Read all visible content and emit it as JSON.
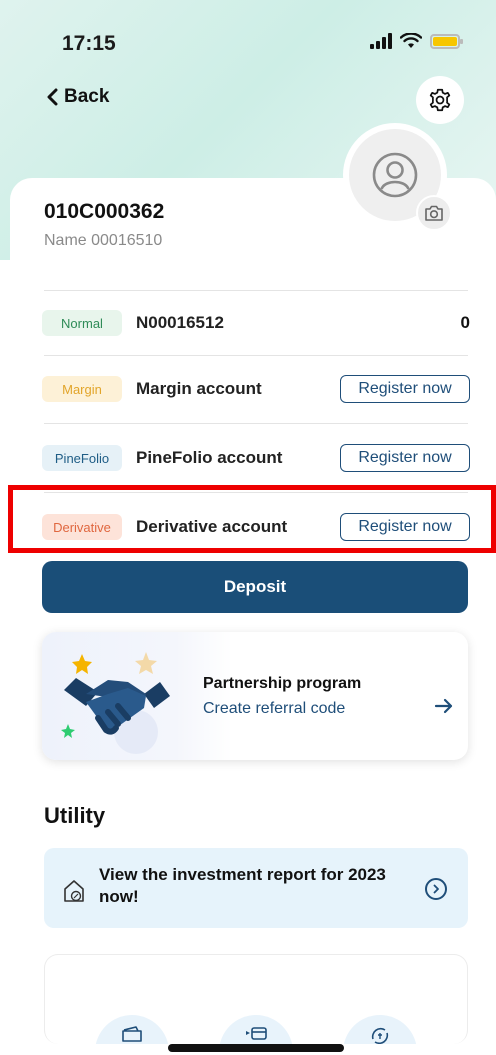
{
  "status_bar": {
    "time": "17:15"
  },
  "header": {
    "back_label": "Back"
  },
  "profile": {
    "account_id": "010C000362",
    "name": "Name 00016510"
  },
  "accounts": [
    {
      "tag": "Normal",
      "title": "N00016512",
      "value": "0"
    },
    {
      "tag": "Margin",
      "title": "Margin account",
      "action": "Register now"
    },
    {
      "tag": "PineFolio",
      "title": "PineFolio account",
      "action": "Register now"
    },
    {
      "tag": "Derivative",
      "title": "Derivative account",
      "action": "Register now"
    }
  ],
  "deposit": {
    "label": "Deposit"
  },
  "partnership": {
    "title": "Partnership program",
    "subtitle": "Create referral code"
  },
  "utility": {
    "title": "Utility",
    "report_text": "View the investment report for 2023 now!"
  },
  "colors": {
    "primary": "#1a4e78",
    "normal_tag": "#2e8b57",
    "margin_tag": "#e2a52a",
    "pinefolio_tag": "#1f5d86",
    "derivative_tag": "#e0673f",
    "highlight": "#ee0000"
  }
}
